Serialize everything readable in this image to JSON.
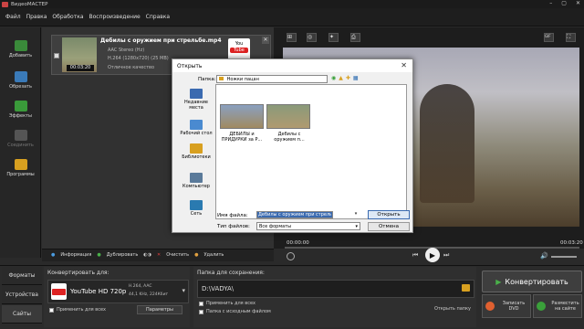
{
  "window": {
    "title": "ВидеоМАСТЕР",
    "min": "–",
    "max": "▢",
    "close": "✕"
  },
  "menu": [
    "Файл",
    "Правка",
    "Обработка",
    "Воспроизведение",
    "Справка"
  ],
  "sidebar": {
    "items": [
      {
        "label": "Добавить",
        "color": "#3a8a3a"
      },
      {
        "label": "Обрезать",
        "color": "#3a7ab8"
      },
      {
        "label": "Эффекты",
        "color": "#3a9a3a"
      },
      {
        "label": "Соединить",
        "color": "#555555"
      },
      {
        "label": "Программы",
        "color": "#d8a020"
      }
    ]
  },
  "file": {
    "name": "Дебилы с оружием при стрельбе.mp4",
    "audio": "AAC Stereo (Hz)",
    "video": "H.264 (1280x720) (25 MB)",
    "status": "Отличное качество",
    "duration": "00:03:20",
    "badge": "YouTube"
  },
  "list_toolbar": {
    "info": "Информация",
    "duplicate": "Дублировать",
    "clear": "Очистить",
    "delete": "Удалить"
  },
  "preview": {
    "time_start": "00:00:00",
    "time_end": "00:03:20",
    "play": "▶",
    "toolbar": [
      "⊞",
      "◎",
      "✦",
      "⎙",
      "GIF",
      "⛶"
    ]
  },
  "bottom": {
    "tabs": [
      "Форматы",
      "Устройства",
      "Сайты"
    ],
    "convert_for_label": "Конвертировать для:",
    "format_name": "YouTube HD 720p",
    "format_spec1": "H.264, AAC",
    "format_spec2": "44,1 KHz, 224Кбит",
    "apply_all": "Применить для всех",
    "params": "Параметры",
    "save_folder_label": "Папка для сохранения:",
    "save_path": "D:\\VADYA\\",
    "apply_all2": "Применить для всех",
    "source_folder": "Папка с исходным файлом",
    "open_folder": "Открыть папку",
    "convert": "Конвертировать",
    "dvd": "Записать DVD",
    "site": "Разместить на сайте"
  },
  "dialog": {
    "title": "Открыть",
    "close": "✕",
    "folder_label": "Папка:",
    "folder_value": "Ножки пацан",
    "places": [
      "Недавние места",
      "Рабочий стол",
      "Библиотеки",
      "Компьютер",
      "Сеть"
    ],
    "files": [
      {
        "name": "ДЕБИЛЫ и ПРИДУРКИ за Р..."
      },
      {
        "name": "Дебилы с оружием п..."
      }
    ],
    "filename_label": "Имя файла:",
    "filename_value": "Дебилы с оружием при стрельбе",
    "filetype_label": "Тип файлов:",
    "filetype_value": "Все форматы",
    "open": "Открыть",
    "cancel": "Отмена"
  }
}
